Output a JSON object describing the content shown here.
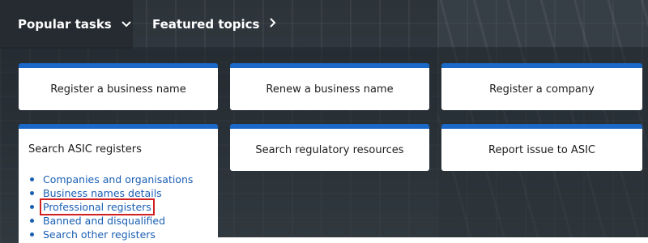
{
  "nav": {
    "popular_label": "Popular tasks",
    "featured_label": "Featured topics"
  },
  "cards": {
    "register_business_name": "Register a business name",
    "renew_business_name": "Renew a business name",
    "register_company": "Register a company",
    "search_regulatory": "Search regulatory resources",
    "report_issue": "Report issue to ASIC"
  },
  "registers": {
    "title": "Search ASIC registers",
    "links": [
      "Companies and organisations",
      "Business names details",
      "Professional registers",
      "Banned and disqualified",
      "Search other registers"
    ],
    "highlighted_index": 2
  },
  "colors": {
    "accent": "#1a68c8",
    "link": "#1a5fb4",
    "highlight": "#d21f1f"
  }
}
